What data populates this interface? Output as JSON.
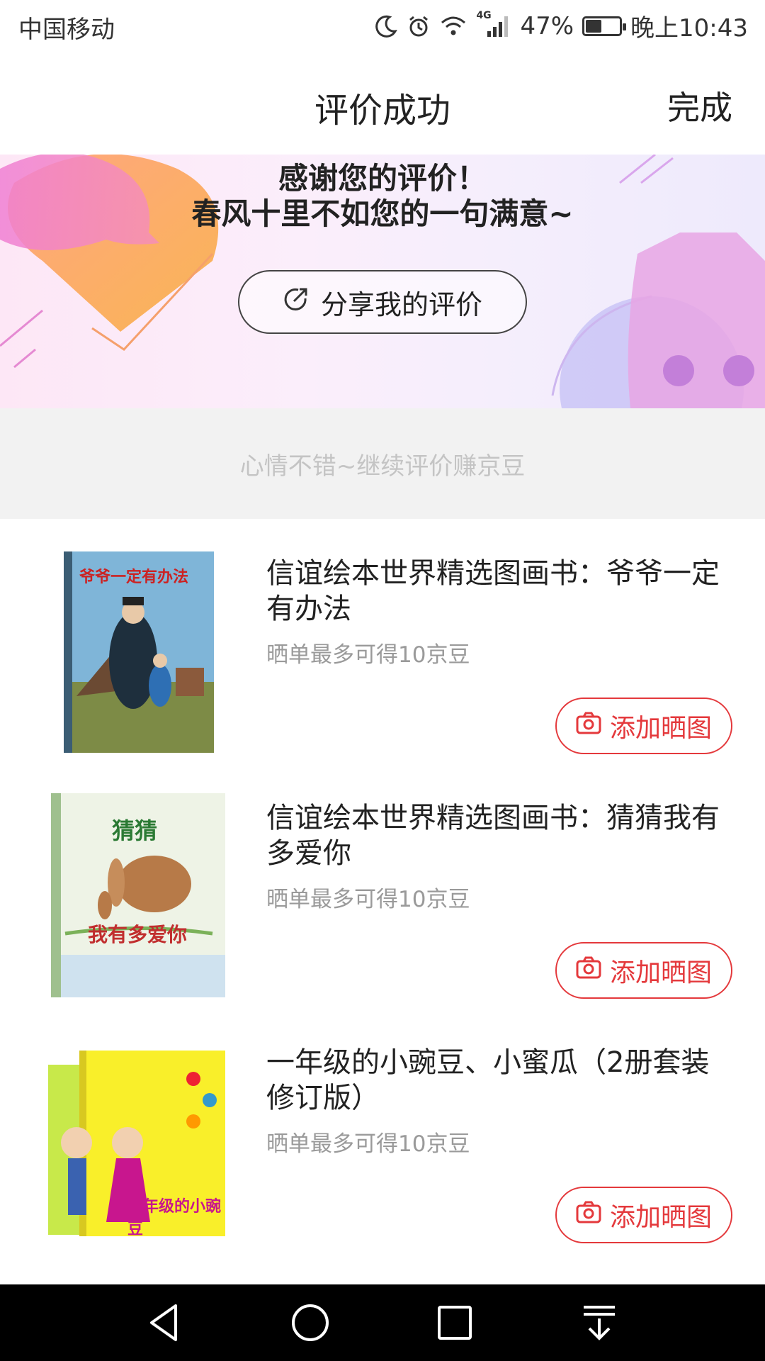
{
  "status_bar": {
    "carrier": "中国移动",
    "network": "4G",
    "battery": "47%",
    "battery_level": 0.47,
    "time": "晚上10:43"
  },
  "nav": {
    "title": "评价成功",
    "done": "完成"
  },
  "banner": {
    "line1": "感谢您的评价！",
    "line2": "春风十里不如您的一句满意~",
    "share_label": "分享我的评价"
  },
  "prompt": "心情不错~继续评价赚京豆",
  "products": [
    {
      "title": "信谊绘本世界精选图画书：爷爷一定有办法",
      "sub": "晒单最多可得10京豆",
      "button": "添加晒图",
      "cover_text": "爷爷一定有办法"
    },
    {
      "title": "信谊绘本世界精选图画书：猜猜我有多爱你",
      "sub": "晒单最多可得10京豆",
      "button": "添加晒图",
      "cover_text_top": "猜猜",
      "cover_text_bottom": "我有多爱你"
    },
    {
      "title": "一年级的小豌豆、小蜜瓜（2册套装 修订版）",
      "sub": "晒单最多可得10京豆",
      "button": "添加晒图",
      "cover_text": "一年级的小豌豆"
    }
  ],
  "colors": {
    "accent": "#e4393c",
    "prompt_bg": "#f2f2f2",
    "sys_nav": "#000000"
  }
}
